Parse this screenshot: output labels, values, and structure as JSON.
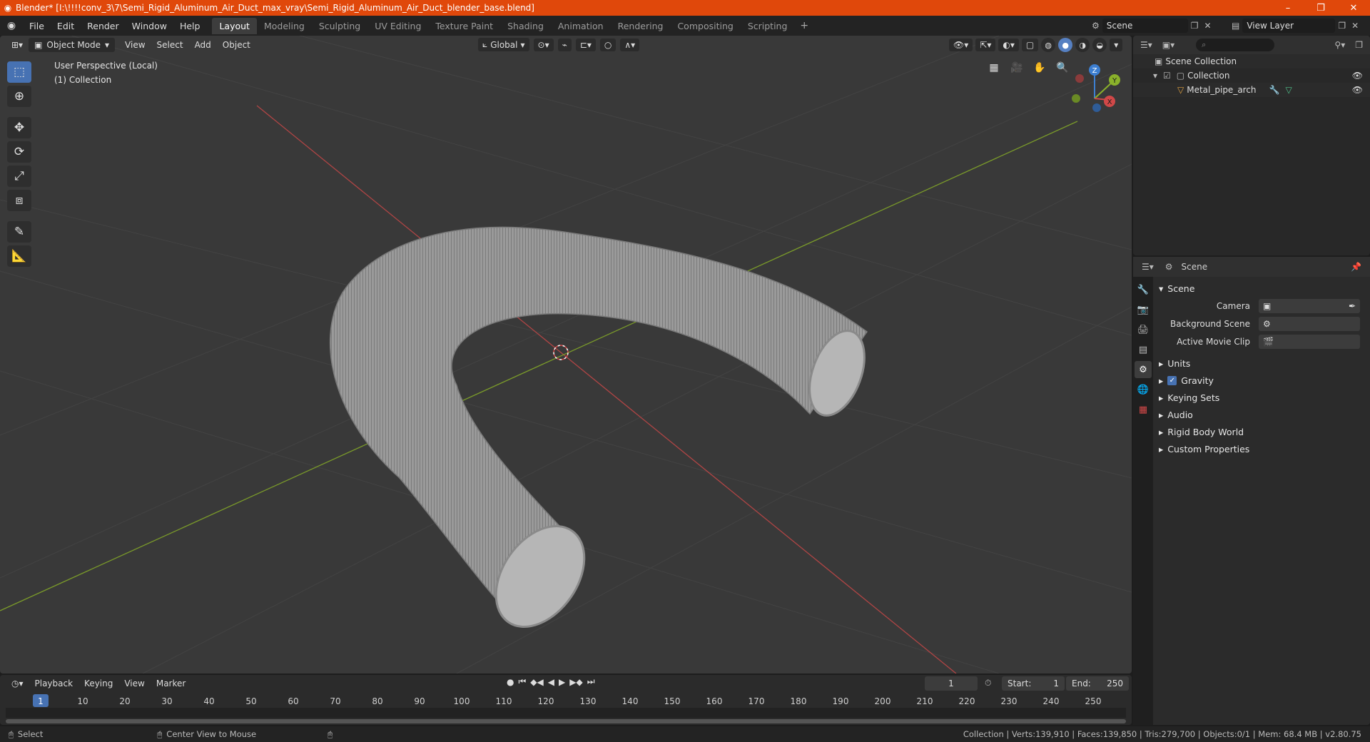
{
  "titlebar": {
    "title": "Blender* [I:\\!!!!conv_3\\7\\Semi_Rigid_Aluminum_Air_Duct_max_vray\\Semi_Rigid_Aluminum_Air_Duct_blender_base.blend]",
    "minimize": "–",
    "maximize": "❐",
    "close": "✕"
  },
  "menubar": {
    "items": [
      "File",
      "Edit",
      "Render",
      "Window",
      "Help"
    ],
    "workspaces": [
      "Layout",
      "Modeling",
      "Sculpting",
      "UV Editing",
      "Texture Paint",
      "Shading",
      "Animation",
      "Rendering",
      "Compositing",
      "Scripting"
    ],
    "active_workspace": "Layout",
    "add": "+",
    "scene": "Scene",
    "view_layer": "View Layer"
  },
  "viewport": {
    "mode": "Object Mode",
    "menus": [
      "View",
      "Select",
      "Add",
      "Object"
    ],
    "transform_orientation": "Global",
    "overlay_line1": "User Perspective (Local)",
    "overlay_line2": "(1) Collection",
    "gizmo": {
      "x": "X",
      "y": "Y",
      "z": "Z"
    },
    "colors": {
      "x_axis": "#d04848",
      "y_axis": "#8ab12b",
      "z_axis": "#3d7fd1"
    }
  },
  "outliner": {
    "search_placeholder": "⌕",
    "scene_collection": "Scene Collection",
    "collection": "Collection",
    "object": "Metal_pipe_arch"
  },
  "properties": {
    "header": "Scene",
    "panel": "Scene",
    "camera_label": "Camera",
    "background_label": "Background Scene",
    "movieclip_label": "Active Movie Clip",
    "sections": [
      "Units",
      "Gravity",
      "Keying Sets",
      "Audio",
      "Rigid Body World",
      "Custom Properties"
    ]
  },
  "timeline": {
    "menus": [
      "Playback",
      "Keying",
      "View",
      "Marker"
    ],
    "current_frame": "1",
    "start_label": "Start:",
    "start": "1",
    "end_label": "End:",
    "end": "250",
    "ticks": [
      "1",
      "10",
      "20",
      "30",
      "40",
      "50",
      "60",
      "70",
      "80",
      "90",
      "100",
      "110",
      "120",
      "130",
      "140",
      "150",
      "160",
      "170",
      "180",
      "190",
      "200",
      "210",
      "220",
      "230",
      "240",
      "250"
    ]
  },
  "statusbar": {
    "select": "Select",
    "center_view": "Center View to Mouse",
    "stats": "Collection | Verts:139,910 | Faces:139,850 | Tris:279,700 | Objects:0/1 | Mem: 68.4 MB | v2.80.75"
  }
}
